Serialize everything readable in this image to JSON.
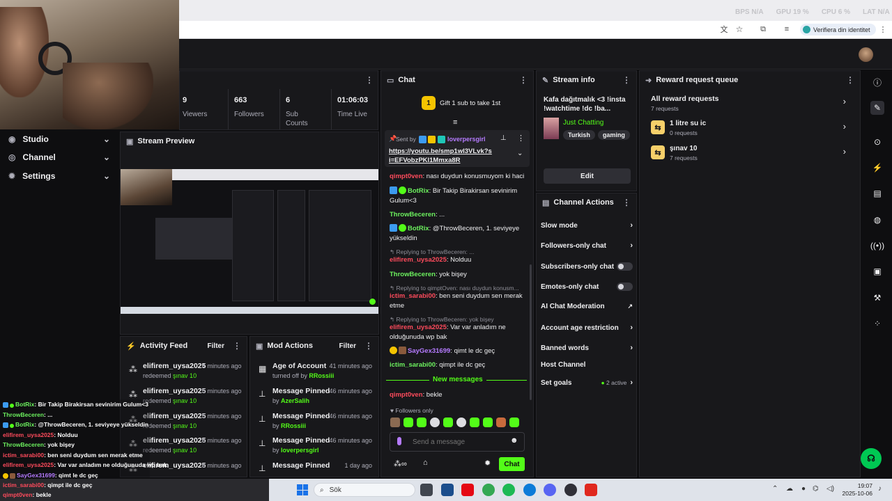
{
  "topbar": {
    "stats": [
      {
        "label": "BPS",
        "value": "N/A"
      },
      {
        "label": "GPU",
        "value": "19 %"
      },
      {
        "label": "CPU",
        "value": "6 %"
      },
      {
        "label": "LAT",
        "value": "N/A"
      }
    ],
    "verify_label": "Verifiera din identitet"
  },
  "nav": {
    "items": [
      {
        "label": "Studio"
      },
      {
        "label": "Channel"
      },
      {
        "label": "Settings"
      }
    ]
  },
  "stats_panel": {
    "items": [
      {
        "value": "9",
        "label": "Viewers"
      },
      {
        "value": "663",
        "label": "Followers"
      },
      {
        "value": "6",
        "label": "Sub Counts"
      },
      {
        "value": "01:06:03",
        "label": "Time Live"
      }
    ]
  },
  "preview": {
    "title": "Stream Preview"
  },
  "chat": {
    "title": "Chat",
    "gift_text": "Gift 1 sub to take 1st",
    "gift_count": "1",
    "pinned": {
      "sent_by_label": "Sent by",
      "user": "loverpersgirl",
      "link": "https://youtu.be/smp1wI3VLvk?si=EFVobzPKl1Mmxa8R"
    },
    "messages": [
      {
        "user": "qimpt0ven",
        "text": "nası duydun konusmuyom ki haci"
      },
      {
        "user": "BotRix",
        "text": "Bir Takip Birakirsan sevinirim Gulum<3"
      },
      {
        "user": "ThrowBeceren",
        "text": "..."
      },
      {
        "user": "BotRix",
        "text": "@ThrowBeceren, 1. seviyeye yükseldin"
      },
      {
        "reply": "Replying to ThrowBeceren: ...",
        "user": "elifirem_uysa2025",
        "text": "Nolduu"
      },
      {
        "user": "ThrowBeceren",
        "text": "yok bişey"
      },
      {
        "reply": "Replying to qimptOven: nası duydun konusm...",
        "user": "ictim_sarabi00",
        "text": "ben seni duydum sen merak etme"
      },
      {
        "reply": "Replying to ThrowBeceren: yok bişey",
        "user": "elifirem_uysa2025",
        "text": "Var var anladım ne olduğunuda wp bak"
      },
      {
        "user": "SayGex31699",
        "text": "qimt le dc geç"
      },
      {
        "user": "ictim_sarabi00",
        "text": "qimpt ile dc geç"
      }
    ],
    "new_messages_label": "New messages",
    "last_message": {
      "user": "qimpt0ven",
      "text": "bekle"
    },
    "followers_only_label": "Followers only",
    "input_placeholder": "Send a message",
    "send_label": "Chat"
  },
  "stream_info": {
    "title": "Stream info",
    "stream_title": "Kafa dağıtmalık <3 !insta !watchtime !dc !ba...",
    "category": "Just Chatting",
    "tags": [
      "Turkish",
      "gaming"
    ],
    "edit_label": "Edit"
  },
  "channel_actions": {
    "title": "Channel Actions",
    "items": [
      {
        "label": "Slow mode",
        "control": "chevron"
      },
      {
        "label": "Followers-only chat",
        "control": "chevron"
      },
      {
        "label": "Subscribers-only chat",
        "control": "toggle"
      },
      {
        "label": "Emotes-only chat",
        "control": "toggle"
      },
      {
        "label": "AI Chat Moderation",
        "control": "external"
      },
      {
        "label": "Account age restriction",
        "control": "chevron"
      },
      {
        "label": "Banned words",
        "control": "chevron"
      },
      {
        "label": "Host Channel",
        "control": "none"
      },
      {
        "label": "Set goals",
        "control": "chevron",
        "extra": "2 active"
      }
    ]
  },
  "reward_queue": {
    "title": "Reward request queue",
    "all_label": "All reward requests",
    "all_count": "7 requests",
    "items": [
      {
        "name": "1 litre su ic",
        "count": "0 requests"
      },
      {
        "name": "şınav 10",
        "count": "7 requests"
      }
    ]
  },
  "activity_feed": {
    "title": "Activity Feed",
    "filter_label": "Filter",
    "items": [
      {
        "user": "elifirem_uysa2025",
        "time": "4 minutes ago",
        "action": "redeemed",
        "reward": "şınav 10"
      },
      {
        "user": "elifirem_uysa2025",
        "time": "5 minutes ago",
        "action": "redeemed",
        "reward": "şınav 10"
      },
      {
        "user": "elifirem_uysa2025",
        "time": "5 minutes ago",
        "action": "redeemed",
        "reward": "şınav 10"
      },
      {
        "user": "elifirem_uysa2025",
        "time": "6 minutes ago",
        "action": "redeemed",
        "reward": "şınav 10"
      },
      {
        "user": "elifirem_uysa2025",
        "time": "6 minutes ago",
        "action": "",
        "reward": ""
      }
    ]
  },
  "mod_actions": {
    "title": "Mod Actions",
    "filter_label": "Filter",
    "items": [
      {
        "title": "Age of Account",
        "time": "41 minutes ago",
        "sub": "turned off by",
        "user": "RRossiii"
      },
      {
        "title": "Message Pinned",
        "time": "46 minutes ago",
        "sub": "by",
        "user": "AzerSalih"
      },
      {
        "title": "Message Pinned",
        "time": "46 minutes ago",
        "sub": "by",
        "user": "RRossiii"
      },
      {
        "title": "Message Pinned",
        "time": "46 minutes ago",
        "sub": "by",
        "user": "loverpersgirl"
      },
      {
        "title": "Message Pinned",
        "time": "1 day ago",
        "sub": "",
        "user": ""
      }
    ]
  },
  "overlay_chat": [
    {
      "user": "BotRix",
      "text": ": Bir Takip Birakirsan sevinirim Gulum<3",
      "color": "#ffffff"
    },
    {
      "user": "ThrowBeceren",
      "text": ": ...",
      "color": "#ffffff"
    },
    {
      "user": "BotRix",
      "text": ": @ThrowBeceren, 1. seviyeye yükseldin",
      "color": "#ffffff"
    },
    {
      "user": "elifirem_uysa2025",
      "text": ": Nolduu",
      "color": "#ffffff"
    },
    {
      "user": "ThrowBeceren",
      "text": ": yok bişey",
      "color": "#ffffff"
    },
    {
      "user": "ictim_sarabi00",
      "text": ": ben seni duydum sen merak etme",
      "color": "#ffffff"
    },
    {
      "user": "elifirem_uysa2025",
      "text": ": Var var anladım ne olduğunuda wp bak",
      "color": "#ffffff"
    },
    {
      "user": "SayGex31699",
      "text": ": qimt le dc geç",
      "color": "#ffffff"
    },
    {
      "user": "ictim_sarabi00",
      "text": ": qimpt ile dc geç",
      "color": "#ffffff"
    },
    {
      "user": "qimpt0ven",
      "text": ": bekle",
      "color": "#ffffff"
    }
  ],
  "taskbar": {
    "search_label": "Sök",
    "time": "19:07",
    "date": "2025-10-06"
  },
  "colors": {
    "accent": "#53fc18",
    "bg": "#0e0e10",
    "panel": "#18181b",
    "chat_red": "#ff4b5c",
    "chat_green": "#6cf05e"
  }
}
